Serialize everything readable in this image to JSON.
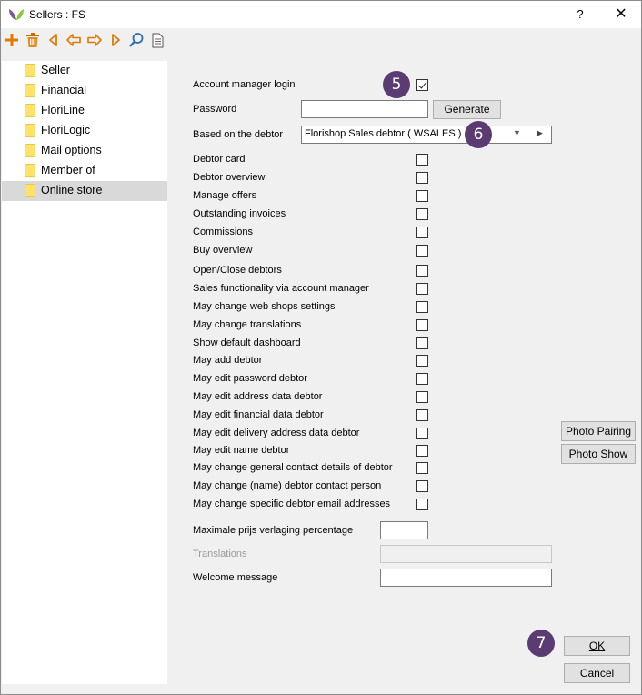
{
  "window": {
    "title": "Sellers : FS",
    "help_label": "?",
    "close_label": "✕"
  },
  "toolbar": {
    "icons": [
      "add-icon",
      "delete-icon",
      "first-icon",
      "previous-icon",
      "next-icon",
      "last-icon",
      "search-icon",
      "document-icon"
    ]
  },
  "sidebar": {
    "items": [
      {
        "label": "Seller"
      },
      {
        "label": "Financial"
      },
      {
        "label": "FloriLine"
      },
      {
        "label": "FloriLogic"
      },
      {
        "label": "Mail options"
      },
      {
        "label": "Member of"
      },
      {
        "label": "Online store",
        "selected": true
      }
    ]
  },
  "form": {
    "account_manager_login": {
      "label": "Account manager login",
      "checked": true
    },
    "password": {
      "label": "Password",
      "value": "",
      "generate_label": "Generate"
    },
    "based_on_debtor": {
      "label": "Based on the debtor",
      "value": "Florishop Sales debtor  ( WSALES )"
    },
    "permissions": [
      {
        "label": "Debtor card",
        "checked": false
      },
      {
        "label": "Debtor overview",
        "checked": false
      },
      {
        "label": "Manage offers",
        "checked": false
      },
      {
        "label": "Outstanding invoices",
        "checked": false
      },
      {
        "label": "Commissions",
        "checked": false
      },
      {
        "label": "Buy overview",
        "checked": false
      },
      {
        "label": "Open/Close debtors",
        "checked": false
      },
      {
        "label": "Sales functionality via account manager",
        "checked": false
      },
      {
        "label": "May change web shops settings",
        "checked": false
      },
      {
        "label": "May change translations",
        "checked": false
      },
      {
        "label": "Show default dashboard",
        "checked": false
      },
      {
        "label": "May add debtor",
        "checked": false
      },
      {
        "label": "May edit password debtor",
        "checked": false
      },
      {
        "label": "May edit address data debtor",
        "checked": false
      },
      {
        "label": "May edit financial data debtor",
        "checked": false
      },
      {
        "label": "May edit delivery address data debtor",
        "checked": false
      },
      {
        "label": "May edit name debtor",
        "checked": false
      },
      {
        "label": "May change general contact details of debtor",
        "checked": false
      },
      {
        "label": "May change (name) debtor contact person",
        "checked": false
      },
      {
        "label": "May change specific debtor email addresses",
        "checked": false
      }
    ],
    "max_price_reduction": {
      "label": "Maximale prijs verlaging percentage",
      "value": ""
    },
    "translations": {
      "label": "Translations",
      "value": ""
    },
    "welcome_message": {
      "label": "Welcome message",
      "value": ""
    }
  },
  "side_buttons": {
    "photo_pairing": "Photo Pairing",
    "photo_show": "Photo Show"
  },
  "footer": {
    "ok_label": "OK",
    "cancel_label": "Cancel"
  },
  "callouts": {
    "five": "5",
    "six": "6",
    "seven": "7"
  },
  "colors": {
    "callout_bg": "#5a3c72",
    "folder": "#ffe26b",
    "selected_item_bg": "#d9d9d9"
  }
}
